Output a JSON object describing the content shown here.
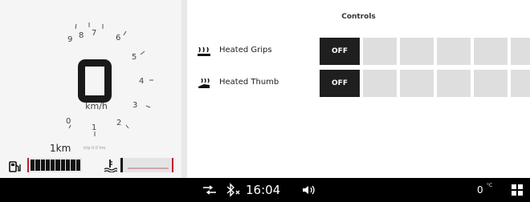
{
  "speedo": {
    "ticks": [
      "9",
      "8",
      "7",
      "6",
      "5",
      "4",
      "3",
      "2",
      "1",
      "0"
    ],
    "unit": "km/h",
    "odometer": "1km",
    "odometer_sub": "trip 0.0 km",
    "fuel_segments": 10
  },
  "controls": {
    "title": "Controls",
    "rows": [
      {
        "label": "Heated Grips",
        "state": "OFF",
        "icon": "heat-wave-icon"
      },
      {
        "label": "Heated Thumb",
        "state": "OFF",
        "icon": "thumb-heat-icon"
      }
    ],
    "levels": 5
  },
  "statusbar": {
    "time": "16:04",
    "temperature": "0",
    "temperature_unit": "°C",
    "icons": [
      "connection-icon",
      "bluetooth-off-icon",
      "volume-icon",
      "apps-grid-icon"
    ]
  },
  "colors": {
    "panel_bg": "#f5f5f5",
    "button_bg": "#1f1f1f",
    "level_bg": "#dedede",
    "accent_red": "#c0202e",
    "statusbar_bg": "#000000"
  }
}
